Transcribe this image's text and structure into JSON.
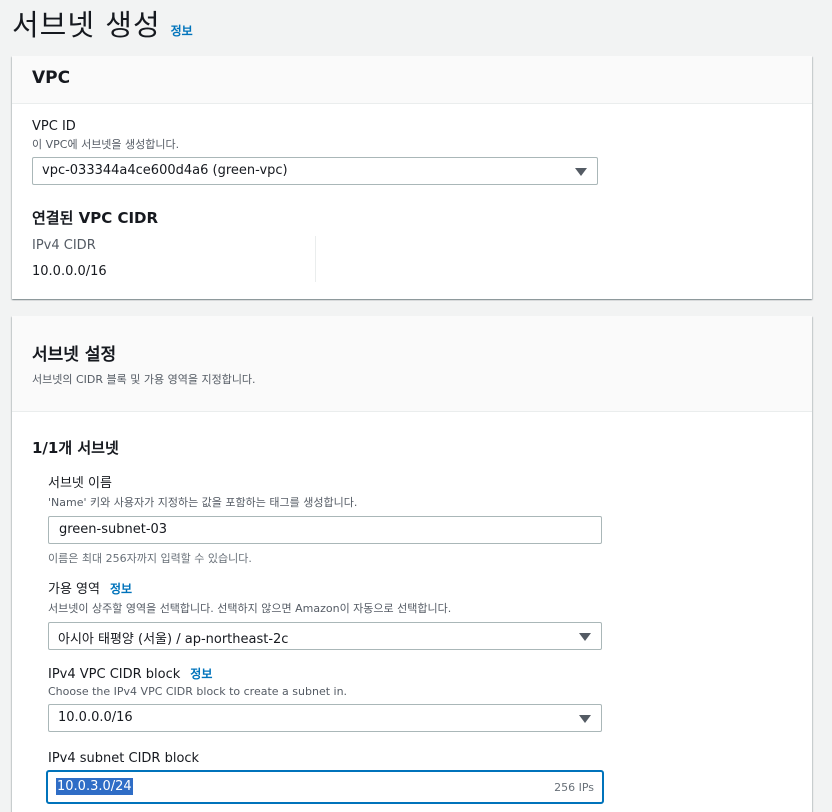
{
  "page": {
    "title": "서브넷 생성",
    "info_link": "정보"
  },
  "vpc_panel": {
    "title": "VPC",
    "vpc_id": {
      "label": "VPC ID",
      "description": "이 VPC에 서브넷을 생성합니다.",
      "selected": "vpc-033344a4ce600d4a6 (green-vpc)"
    },
    "associated_cidr": {
      "heading": "연결된 VPC CIDR",
      "ipv4_label": "IPv4 CIDR",
      "ipv4_value": "10.0.0.0/16"
    }
  },
  "subnet_panel": {
    "title": "서브넷 설정",
    "description": "서브넷의 CIDR 블록 및 가용 영역을 지정합니다.",
    "subnet_count": "1/1개 서브넷",
    "name_field": {
      "label": "서브넷 이름",
      "description": "'Name' 키와 사용자가 지정하는 값을 포함하는 태그를 생성합니다.",
      "value": "green-subnet-03",
      "hint": "이름은 최대 256자까지 입력할 수 있습니다."
    },
    "az_field": {
      "label": "가용 영역",
      "info_link": "정보",
      "description": "서브넷이 상주할 영역을 선택합니다. 선택하지 않으면 Amazon이 자동으로 선택합니다.",
      "selected": "아시아 태평양 (서울) / ap-northeast-2c"
    },
    "vpc_cidr_field": {
      "label": "IPv4 VPC CIDR block",
      "info_link": "정보",
      "description": "Choose the IPv4 VPC CIDR block to create a subnet in.",
      "selected": "10.0.0.0/16"
    },
    "subnet_cidr_field": {
      "label": "IPv4 subnet CIDR block",
      "value": "10.0.3.0/24",
      "ip_count": "256 IPs"
    }
  },
  "colors": {
    "background": "#f2f3f3",
    "link": "#0073bb",
    "focus_border": "#0073bb",
    "selection": "#2f6dc6"
  }
}
